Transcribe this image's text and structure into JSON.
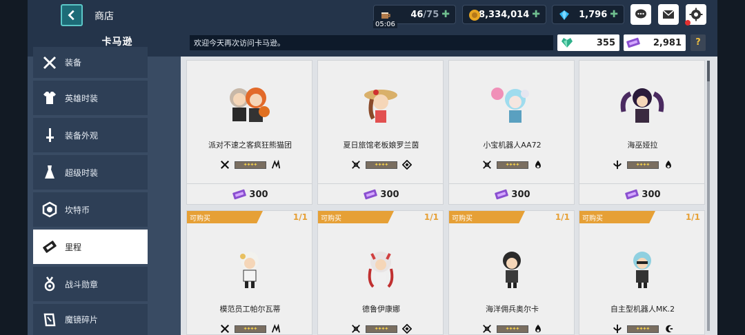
{
  "header": {
    "title": "商店",
    "stamina": {
      "value": "46",
      "max": "/75",
      "timer": "05:06"
    },
    "gold": "48,334,014",
    "gems": "1,796"
  },
  "shop_tab": "卡马逊",
  "welcome": "欢迎今天再次访问卡马逊。",
  "currencies": {
    "heart_crystal": "355",
    "ticket": "2,981"
  },
  "help_label": "?",
  "sidebar": {
    "items": [
      {
        "label": "装备"
      },
      {
        "label": "英雄时装"
      },
      {
        "label": "装备外观"
      },
      {
        "label": "超级时装"
      },
      {
        "label": "坎特币"
      },
      {
        "label": "里程"
      },
      {
        "label": "战斗勋章"
      },
      {
        "label": "魔镜碎片"
      }
    ]
  },
  "products": [
    {
      "name": "派对不速之客疯狂熊猫团",
      "price": "300"
    },
    {
      "name": "夏日旅馆老板娘罗兰茵",
      "price": "300"
    },
    {
      "name": "小宝机器人AA72",
      "price": "300"
    },
    {
      "name": "海巫娅拉",
      "price": "300"
    },
    {
      "name": "模范员工帕尔瓦蒂",
      "tag": "可购买",
      "limit_a": "1",
      "limit_b": "/1"
    },
    {
      "name": "德鲁伊康娜",
      "tag": "可购买",
      "limit_a": "1",
      "limit_b": "/1"
    },
    {
      "name": "海洋佣兵奥尔卡",
      "tag": "可购买",
      "limit_a": "1",
      "limit_b": "/1"
    },
    {
      "name": "自主型机器人MK.2",
      "tag": "可购买",
      "limit_a": "1",
      "limit_b": "/1"
    }
  ],
  "colors": {
    "accent": "#e6a036",
    "panel": "#394b63",
    "teal": "#1d6b77"
  }
}
